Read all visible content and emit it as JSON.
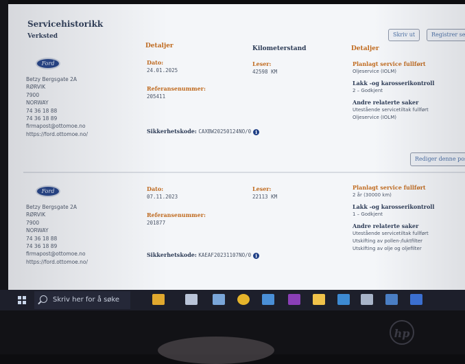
{
  "page": {
    "title": "Servicehistorikk",
    "print_button": "Skriv ut",
    "register_button": "Registrer se"
  },
  "columns": {
    "workshop": "Verksted",
    "details": "Detaljer",
    "mileage": "Kilometerstand",
    "details2": "Detaljer"
  },
  "records": [
    {
      "logo_text": "Ford",
      "address": [
        "Betzy Bergsgate 2A",
        "RØRVIK",
        "7900",
        "NORWAY",
        "74 36 18 88",
        "74 36 18 89",
        "firmapost@ottomoe.no",
        "https://ford.ottomoe.no/"
      ],
      "date_label": "Dato:",
      "date": "24.01.2025",
      "reader_label": "Leser:",
      "reader": "42598 KM",
      "ref_label": "Referansenummer:",
      "ref": "205411",
      "security_label": "Sikkerhetskode:",
      "security_code": "CAXBW20250124NO/0",
      "planned_title": "Planlagt service fullført",
      "planned_value": "Oljeservice (IOLM)",
      "paint_title": "Lakk -og karosserikontroll",
      "paint_value": "2 – Godkjent",
      "other_title": "Andre relaterte saker",
      "other_values": [
        "Utestående servicetiltak fullført",
        "Oljeservice (IOLM)"
      ],
      "edit_button": "Rediger denne pos"
    },
    {
      "logo_text": "Ford",
      "address": [
        "Betzy Bergsgate 2A",
        "RØRVIK",
        "7900",
        "NORWAY",
        "74 36 18 88",
        "74 36 18 89",
        "firmapost@ottomoe.no",
        "https://ford.ottomoe.no/"
      ],
      "date_label": "Dato:",
      "date": "07.11.2023",
      "reader_label": "Leser:",
      "reader": "22113 KM",
      "ref_label": "Referansenummer:",
      "ref": "201877",
      "security_label": "Sikkerhetskode:",
      "security_code": "KAEAF20231107NO/0",
      "planned_title": "Planlagt service fullført",
      "planned_value": "2 år (30000 km)",
      "paint_title": "Lakk -og karosserikontroll",
      "paint_value": "1 – Godkjent",
      "other_title": "Andre relaterte saker",
      "other_values": [
        "Utestående servicetiltak fullført",
        "Utskifting av pollen-/luktfilter",
        "Utskifting av olje og oljefilter"
      ]
    }
  ],
  "taskbar": {
    "search_placeholder": "Skriv her for å søke",
    "icons": [
      "briefcase-icon",
      "task-view-icon",
      "paint-icon",
      "chrome-icon",
      "files-icon",
      "onenote-icon",
      "explorer-icon",
      "mail-icon",
      "network-icon",
      "remote-icon",
      "store-icon"
    ],
    "icon_colors": [
      "#e0a82e",
      "#b9c4d8",
      "#7aa6d9",
      "#e5b42b",
      "#4a8fd6",
      "#8a3fb6",
      "#f0c24a",
      "#3d8ad3",
      "#a8b4c8",
      "#4a7ec4",
      "#3b6fd0"
    ]
  },
  "device": {
    "brand": "hp"
  },
  "colors": {
    "heading_blue": "#2b3a55",
    "label_orange": "#c06a1e",
    "button_text": "#4a6fa5"
  }
}
